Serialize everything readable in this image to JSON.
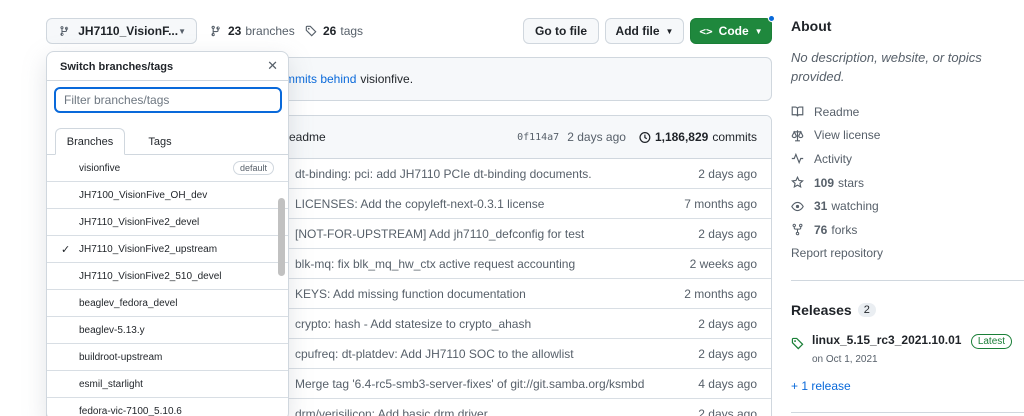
{
  "toolbar": {
    "branch": "JH7110_VisionF...",
    "branches_count": "23",
    "branches_label": "branches",
    "tags_count": "26",
    "tags_label": "tags",
    "go_to_file": "Go to file",
    "add_file": "Add file",
    "code": "Code"
  },
  "banner": {
    "link": "mmits behind",
    "target": "visionfive."
  },
  "latest_commit": {
    "message": "readme",
    "sha": "0f114a7",
    "ago": "2 days ago",
    "commits_count": "1,186,829",
    "commits_label": "commits"
  },
  "files": [
    {
      "message": "dt-binding: pci: add JH7110 PCIe dt-binding documents.",
      "date": "2 days ago"
    },
    {
      "message": "LICENSES: Add the copyleft-next-0.3.1 license",
      "date": "7 months ago"
    },
    {
      "message": "[NOT-FOR-UPSTREAM] Add jh7110_defconfig for test",
      "date": "2 days ago"
    },
    {
      "message": "blk-mq: fix blk_mq_hw_ctx active request accounting",
      "date": "2 weeks ago"
    },
    {
      "message": "KEYS: Add missing function documentation",
      "date": "2 months ago"
    },
    {
      "message": "crypto: hash - Add statesize to crypto_ahash",
      "date": "2 days ago"
    },
    {
      "message": "cpufreq: dt-platdev: Add JH7110 SOC to the allowlist",
      "date": "2 days ago"
    },
    {
      "message": "Merge tag '6.4-rc5-smb3-server-fixes' of git://git.samba.org/ksmbd",
      "date": "4 days ago"
    },
    {
      "message": "drm/verisilicon: Add basic drm driver",
      "date": "2 days ago"
    }
  ],
  "about": {
    "title": "About",
    "description": "No description, website, or topics provided.",
    "readme": "Readme",
    "license": "View license",
    "activity": "Activity",
    "stars_count": "109",
    "stars_label": "stars",
    "watching_count": "31",
    "watching_label": "watching",
    "forks_count": "76",
    "forks_label": "forks",
    "report": "Report repository"
  },
  "releases": {
    "title": "Releases",
    "count": "2",
    "name": "linux_5.15_rc3_2021.10.01",
    "badge": "Latest",
    "date": "on Oct 1, 2021",
    "more": "+ 1 release"
  },
  "dropdown": {
    "title": "Switch branches/tags",
    "filter_placeholder": "Filter branches/tags",
    "tab_branches": "Branches",
    "tab_tags": "Tags",
    "default_badge": "default",
    "branches": [
      "visionfive",
      "JH7100_VisionFive_OH_dev",
      "JH7110_VisionFive2_devel",
      "JH7110_VisionFive2_upstream",
      "JH7110_VisionFive2_510_devel",
      "beaglev_fedora_devel",
      "beaglev-5.13.y",
      "buildroot-upstream",
      "esmil_starlight",
      "fedora-vic-7100_5.10.6"
    ]
  }
}
